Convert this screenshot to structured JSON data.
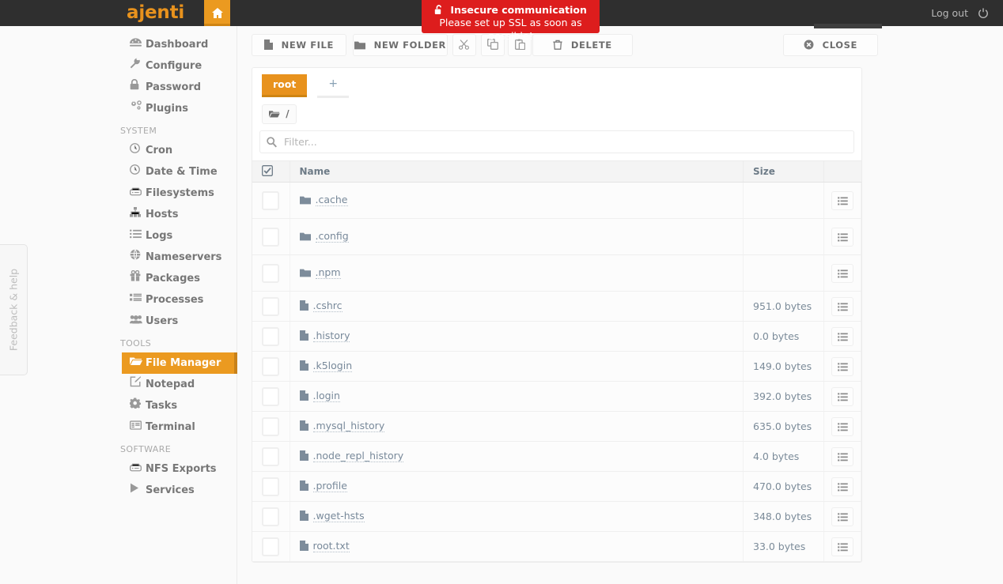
{
  "app": {
    "brand": "ajenti",
    "home_icon": "home-icon",
    "logout_label": "Log out",
    "power_icon": "power-icon",
    "accent": "#eb9a20",
    "header_bg": "#2f2f2f"
  },
  "notification": {
    "icon": "unlock-icon",
    "title": "Insecure communication",
    "subtitle": "Please set up SSL as soon as possible!",
    "color": "#dd1d1d"
  },
  "sidebar": {
    "items": [
      {
        "label": "Dashboard",
        "icon": "dashboard-icon",
        "active": false,
        "type": "item"
      },
      {
        "label": "Configure",
        "icon": "wrench-icon",
        "active": false,
        "type": "item"
      },
      {
        "label": "Password",
        "icon": "lock-icon",
        "active": false,
        "type": "item"
      },
      {
        "label": "Plugins",
        "icon": "gears-icon",
        "active": false,
        "type": "item"
      },
      {
        "label": "SYSTEM",
        "type": "group"
      },
      {
        "label": "Cron",
        "icon": "clock-icon",
        "active": false,
        "type": "item"
      },
      {
        "label": "Date & Time",
        "icon": "clock-icon",
        "active": false,
        "type": "item"
      },
      {
        "label": "Filesystems",
        "icon": "hdd-icon",
        "active": false,
        "type": "item"
      },
      {
        "label": "Hosts",
        "icon": "sitemap-icon",
        "active": false,
        "type": "item"
      },
      {
        "label": "Logs",
        "icon": "list-icon",
        "active": false,
        "type": "item"
      },
      {
        "label": "Nameservers",
        "icon": "globe-icon",
        "active": false,
        "type": "item"
      },
      {
        "label": "Packages",
        "icon": "gift-icon",
        "active": false,
        "type": "item"
      },
      {
        "label": "Processes",
        "icon": "tasks-icon",
        "active": false,
        "type": "item"
      },
      {
        "label": "Users",
        "icon": "users-icon",
        "active": false,
        "type": "item"
      },
      {
        "label": "TOOLS",
        "type": "group"
      },
      {
        "label": "File Manager",
        "icon": "folder-open-icon",
        "active": true,
        "type": "item"
      },
      {
        "label": "Notepad",
        "icon": "pencil-square-icon",
        "active": false,
        "type": "item"
      },
      {
        "label": "Tasks",
        "icon": "gear-icon",
        "active": false,
        "type": "item"
      },
      {
        "label": "Terminal",
        "icon": "terminal-icon",
        "active": false,
        "type": "item"
      },
      {
        "label": "SOFTWARE",
        "type": "group"
      },
      {
        "label": "NFS Exports",
        "icon": "hdd-icon",
        "active": false,
        "type": "item"
      },
      {
        "label": "Services",
        "icon": "play-icon",
        "active": false,
        "type": "item"
      }
    ]
  },
  "feedback_tab": {
    "label": "Feedback & help"
  },
  "toolbar": {
    "new_file": {
      "label": "NEW FILE",
      "icon": "file-icon"
    },
    "new_folder": {
      "label": "NEW FOLDER",
      "icon": "folder-icon"
    },
    "cut": {
      "label": "",
      "icon": "scissors-icon"
    },
    "copy": {
      "label": "",
      "icon": "copy-icon"
    },
    "paste": {
      "label": "",
      "icon": "paste-icon"
    },
    "delete": {
      "label": "DELETE",
      "icon": "trash-icon"
    },
    "close": {
      "label": "CLOSE",
      "icon": "times-circle-icon"
    }
  },
  "tabs": {
    "items": [
      {
        "label": "root",
        "active": true
      }
    ],
    "add_label": "+"
  },
  "path": {
    "icon": "folder-open-icon",
    "segments": "/"
  },
  "filter": {
    "placeholder": "Filter...",
    "value": "",
    "icon": "search-icon"
  },
  "table": {
    "columns": [
      "",
      "Name",
      "Size",
      ""
    ],
    "header_check_icon": "checkbox-checked-icon",
    "row_action_icon": "list-menu-icon",
    "rows": [
      {
        "name": ".cache",
        "size": "",
        "kind": "dir",
        "icon": "folder-icon",
        "checked": false
      },
      {
        "name": ".config",
        "size": "",
        "kind": "dir",
        "icon": "folder-icon",
        "checked": false
      },
      {
        "name": ".npm",
        "size": "",
        "kind": "dir",
        "icon": "folder-icon",
        "checked": false
      },
      {
        "name": ".cshrc",
        "size": "951.0 bytes",
        "kind": "file",
        "icon": "file-icon",
        "checked": false
      },
      {
        "name": ".history",
        "size": "0.0 bytes",
        "kind": "file",
        "icon": "file-icon",
        "checked": false
      },
      {
        "name": ".k5login",
        "size": "149.0 bytes",
        "kind": "file",
        "icon": "file-icon",
        "checked": false
      },
      {
        "name": ".login",
        "size": "392.0 bytes",
        "kind": "file",
        "icon": "file-icon",
        "checked": false
      },
      {
        "name": ".mysql_history",
        "size": "635.0 bytes",
        "kind": "file",
        "icon": "file-icon",
        "checked": false
      },
      {
        "name": ".node_repl_history",
        "size": "4.0 bytes",
        "kind": "file",
        "icon": "file-icon",
        "checked": false
      },
      {
        "name": ".profile",
        "size": "470.0 bytes",
        "kind": "file",
        "icon": "file-icon",
        "checked": false
      },
      {
        "name": ".wget-hsts",
        "size": "348.0 bytes",
        "kind": "file",
        "icon": "file-icon",
        "checked": false
      },
      {
        "name": "root.txt",
        "size": "33.0 bytes",
        "kind": "file",
        "icon": "file-icon",
        "checked": false
      }
    ]
  }
}
